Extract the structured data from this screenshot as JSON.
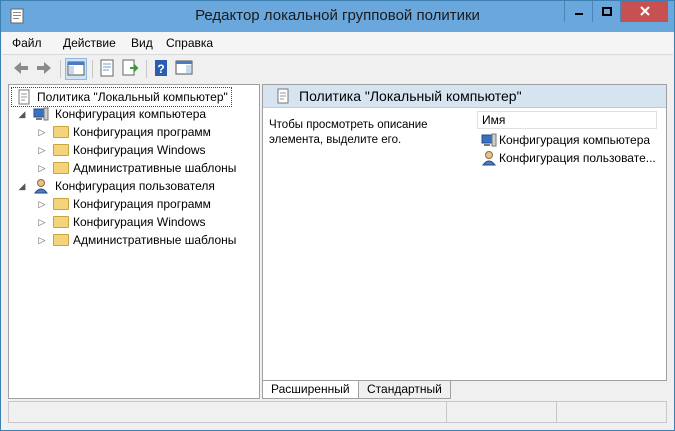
{
  "window": {
    "title": "Редактор локальной групповой политики"
  },
  "menu": [
    "Файл",
    "Действие",
    "Вид",
    "Справка"
  ],
  "tree": {
    "root": "Политика \"Локальный компьютер\"",
    "computer": {
      "label": "Конфигурация компьютера",
      "children": [
        "Конфигурация программ",
        "Конфигурация Windows",
        "Административные шаблоны"
      ]
    },
    "user": {
      "label": "Конфигурация пользователя",
      "children": [
        "Конфигурация программ",
        "Конфигурация Windows",
        "Административные шаблоны"
      ]
    }
  },
  "right": {
    "title": "Политика \"Локальный компьютер\"",
    "description": "Чтобы просмотреть описание элемента, выделите его.",
    "column_header": "Имя",
    "items": [
      "Конфигурация компьютера",
      "Конфигурация пользовате..."
    ]
  },
  "tabs": [
    "Расширенный",
    "Стандартный"
  ],
  "icons": {
    "back": "back-arrow-icon",
    "forward": "forward-arrow-icon",
    "console_tree": "show-hide-console-tree-icon",
    "properties": "properties-icon",
    "export": "export-list-icon",
    "help": "help-icon",
    "action_pane": "show-action-pane-icon"
  },
  "colors": {
    "titlebar": "#6aa7dd",
    "close": "#c75050",
    "header": "#d6e4f2"
  }
}
